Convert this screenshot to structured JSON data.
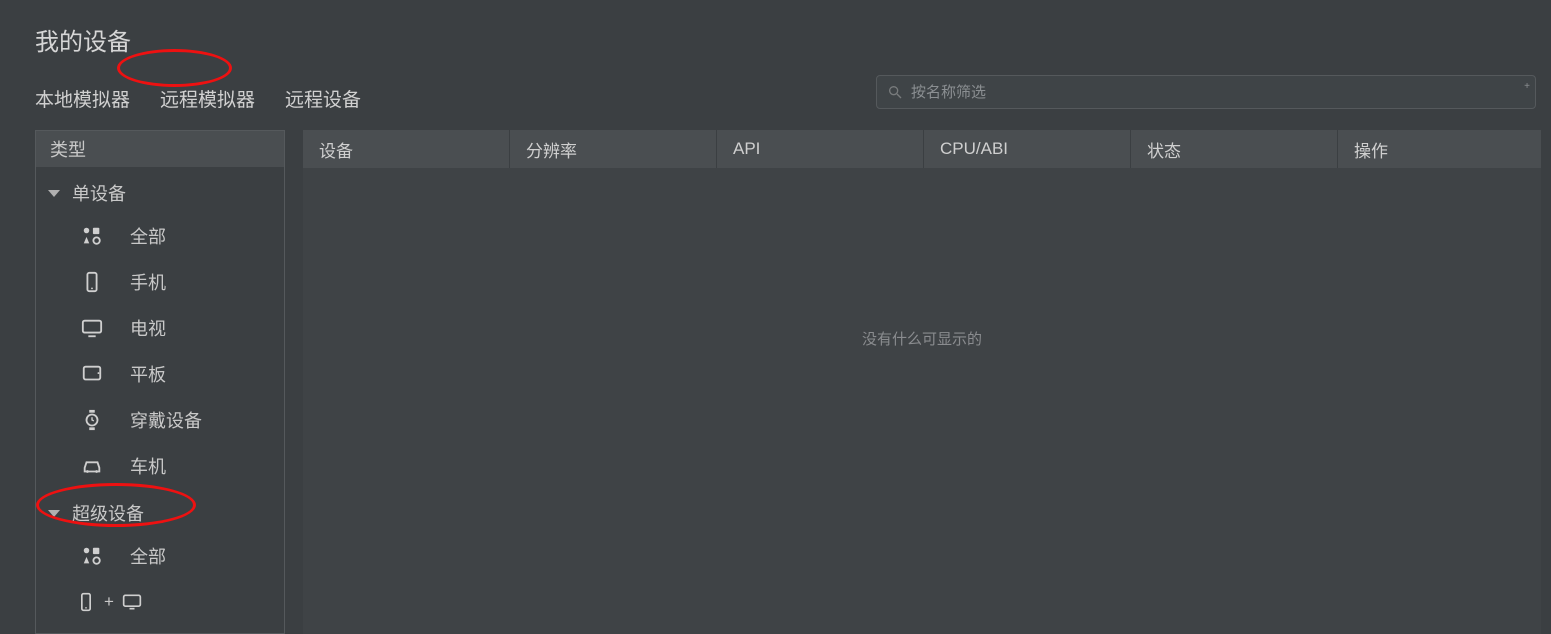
{
  "title": "我的设备",
  "tabs": [
    "本地模拟器",
    "远程模拟器",
    "远程设备"
  ],
  "search": {
    "placeholder": "按名称筛选"
  },
  "sidebar": {
    "header": "类型",
    "group1": {
      "label": "单设备",
      "items": [
        {
          "icon": "all",
          "label": "全部"
        },
        {
          "icon": "phone",
          "label": "手机"
        },
        {
          "icon": "tv",
          "label": "电视"
        },
        {
          "icon": "tablet",
          "label": "平板"
        },
        {
          "icon": "watch",
          "label": "穿戴设备"
        },
        {
          "icon": "car",
          "label": "车机"
        }
      ]
    },
    "group2": {
      "label": "超级设备",
      "items": [
        {
          "icon": "all",
          "label": "全部"
        },
        {
          "icon": "phone+monitor",
          "label": ""
        }
      ]
    }
  },
  "table": {
    "columns": [
      "设备",
      "分辨率",
      "API",
      "CPU/ABI",
      "状态",
      "操作"
    ],
    "empty_text": "没有什么可显示的"
  },
  "annotations": {
    "tab_remote_emulator_circled": true,
    "group_super_device_circled": true
  }
}
